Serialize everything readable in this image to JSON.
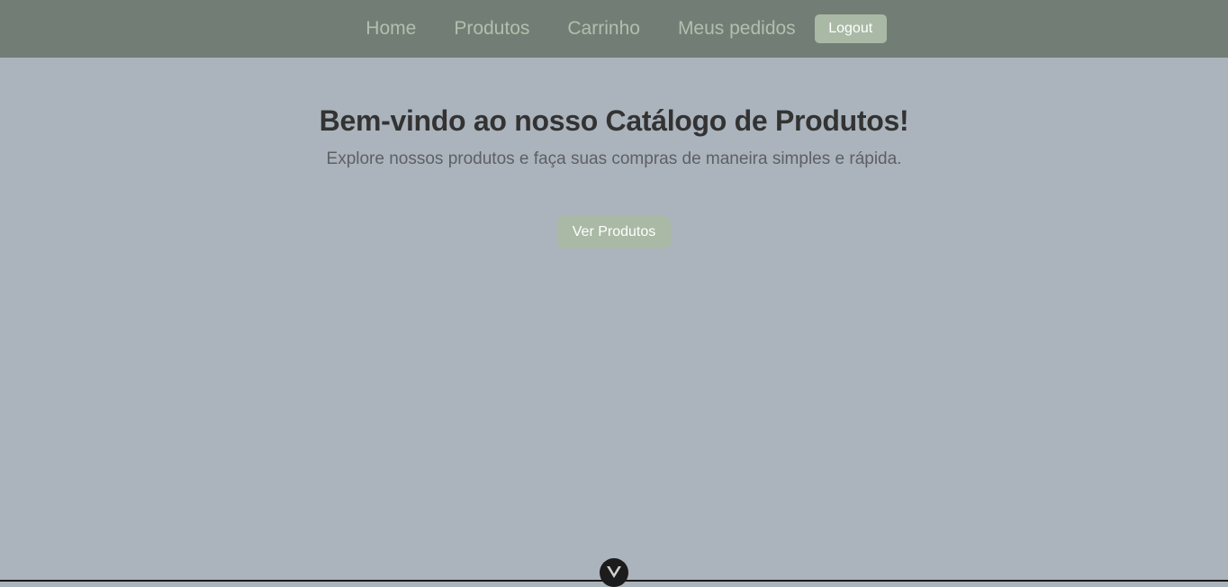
{
  "nav": {
    "links": [
      {
        "label": "Home"
      },
      {
        "label": "Produtos"
      },
      {
        "label": "Carrinho"
      },
      {
        "label": "Meus pedidos"
      }
    ],
    "logout_label": "Logout"
  },
  "hero": {
    "title": "Bem-vindo ao nosso Catálogo de Produtos!",
    "subtitle": "Explore nossos produtos e faça suas compras de maneira simples e rápida.",
    "cta_label": "Ver Produtos"
  },
  "icons": {
    "scroll_button": "vue-logo-icon"
  },
  "colors": {
    "navbar_bg": "#727d75",
    "page_bg": "#abb4bc",
    "accent": "#a9b9a5",
    "nav_link": "#b3bfad",
    "title": "#333333",
    "subtitle": "#5d6064"
  }
}
